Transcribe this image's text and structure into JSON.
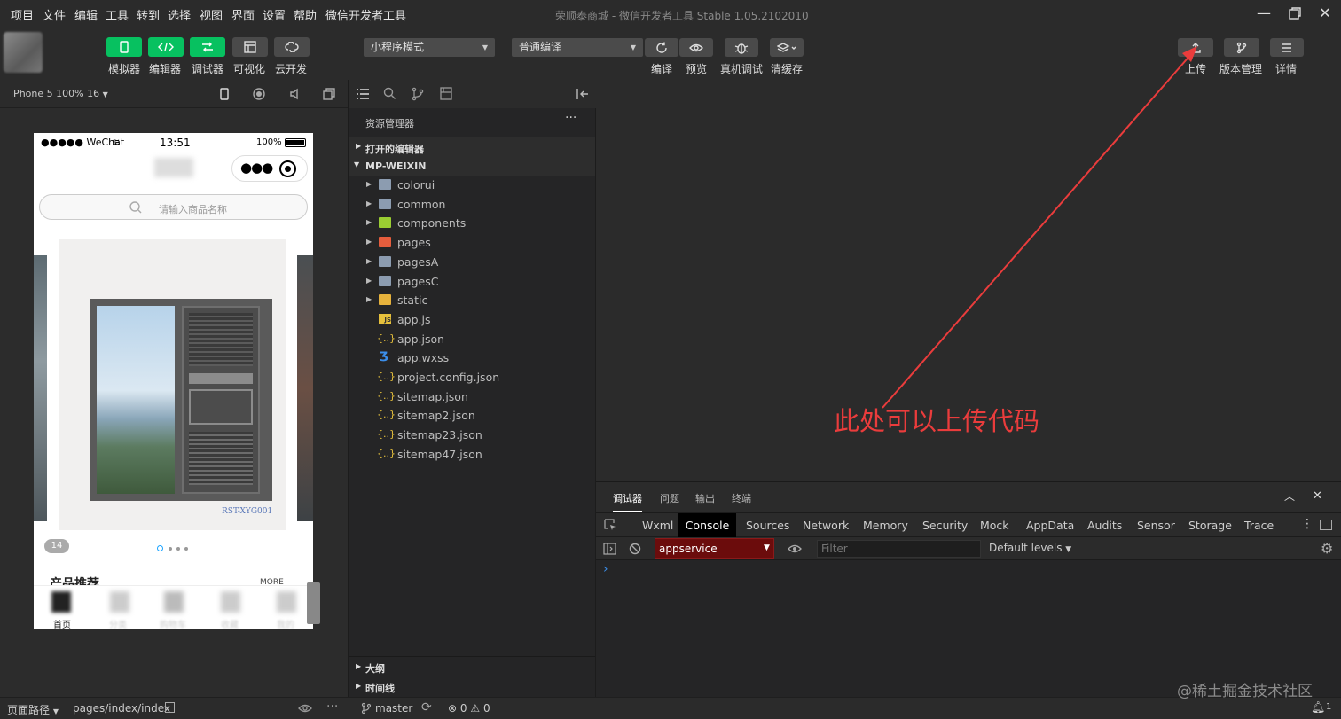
{
  "menu": [
    "项目",
    "文件",
    "编辑",
    "工具",
    "转到",
    "选择",
    "视图",
    "界面",
    "设置",
    "帮助",
    "微信开发者工具"
  ],
  "window": {
    "title": "荣顺泰商城 - 微信开发者工具 Stable 1.05.2102010"
  },
  "toolbar": {
    "left_buttons": [
      {
        "label": "模拟器",
        "icon": "phone-icon"
      },
      {
        "label": "编辑器",
        "icon": "code-icon"
      },
      {
        "label": "调试器",
        "icon": "debug-icon"
      },
      {
        "label": "可视化",
        "icon": "layout-icon"
      },
      {
        "label": "云开发",
        "icon": "cloud-icon"
      }
    ],
    "mode_select": "小程序模式",
    "compile_select": "普通编译",
    "mid_buttons": [
      {
        "label": "编译",
        "icon": "refresh-icon"
      },
      {
        "label": "预览",
        "icon": "eye-icon"
      },
      {
        "label": "真机调试",
        "icon": "bug-icon"
      },
      {
        "label": "清缓存",
        "icon": "layers-icon"
      }
    ],
    "right_buttons": [
      {
        "label": "上传",
        "icon": "upload-icon"
      },
      {
        "label": "版本管理",
        "icon": "branch-icon"
      },
      {
        "label": "详情",
        "icon": "menu-icon"
      }
    ]
  },
  "simulator": {
    "device": "iPhone 5 100% 16",
    "status_bar": {
      "carrier": "●●●●● WeChat",
      "time": "13:51",
      "battery": "100%"
    },
    "search_placeholder": "请输入商品名称",
    "banner_caption": "RST-XYG001",
    "banner_index": "1",
    "banner_total": "4",
    "section_title": "产品推荐",
    "section_more": "MORE",
    "tabbar": [
      "首页",
      "分类",
      "购物车",
      "收藏",
      "我的"
    ],
    "footer": {
      "label": "页面路径",
      "path": "pages/index/index"
    }
  },
  "explorer": {
    "title": "资源管理器",
    "open_editors": "打开的编辑器",
    "project": "MP-WEIXIN",
    "items": [
      {
        "name": "colorui",
        "type": "folder"
      },
      {
        "name": "common",
        "type": "folder"
      },
      {
        "name": "components",
        "type": "folder-components"
      },
      {
        "name": "pages",
        "type": "folder-pages"
      },
      {
        "name": "pagesA",
        "type": "folder"
      },
      {
        "name": "pagesC",
        "type": "folder"
      },
      {
        "name": "static",
        "type": "folder-static"
      },
      {
        "name": "app.js",
        "type": "js"
      },
      {
        "name": "app.json",
        "type": "json"
      },
      {
        "name": "app.wxss",
        "type": "css"
      },
      {
        "name": "project.config.json",
        "type": "json"
      },
      {
        "name": "sitemap.json",
        "type": "json"
      },
      {
        "name": "sitemap2.json",
        "type": "json"
      },
      {
        "name": "sitemap23.json",
        "type": "json"
      },
      {
        "name": "sitemap47.json",
        "type": "json"
      }
    ],
    "outline": "大纲",
    "timeline": "时间线",
    "status": {
      "branch": "master",
      "errors": "0",
      "warnings": "0"
    }
  },
  "annotation": "此处可以上传代码",
  "debugger": {
    "tabs": [
      "调试器",
      "问题",
      "输出",
      "终端"
    ],
    "dev_tabs": [
      "Wxml",
      "Console",
      "Sources",
      "Network",
      "Memory",
      "Security",
      "Mock",
      "AppData",
      "Audits",
      "Sensor",
      "Storage",
      "Trace"
    ],
    "active_dev_tab": "Console",
    "context": "appservice",
    "filter_placeholder": "Filter",
    "levels": "Default levels",
    "prompt": "›"
  },
  "watermark": "@稀土掘金技术社区",
  "colors": {
    "green": "#07c160",
    "annotation": "#ea3c3c",
    "context_bg": "#6b0c0c"
  }
}
